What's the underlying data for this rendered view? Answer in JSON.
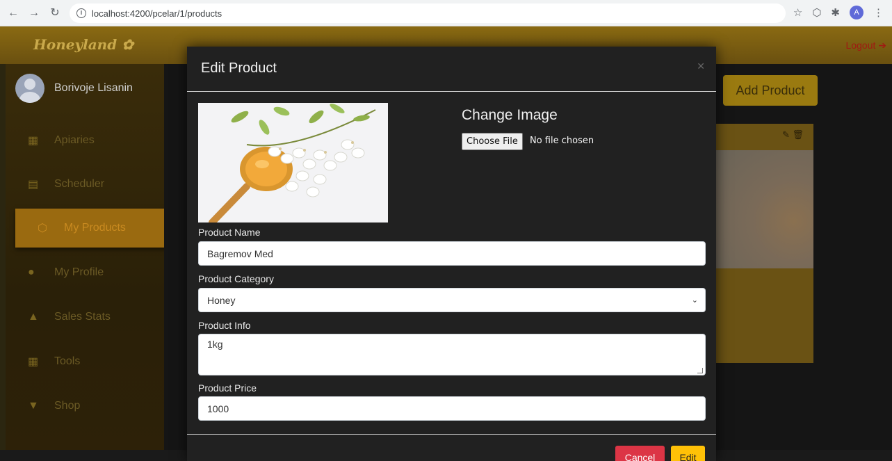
{
  "browser": {
    "url": "localhost:4200/pcelar/1/products",
    "profile_initial": "A"
  },
  "app": {
    "logo": "Honeyland",
    "logout": "Logout",
    "user_name": "Borivoje Lisanin",
    "sidebar": {
      "items": [
        {
          "label": "Apiaries",
          "icon": "hive-icon",
          "glyph": "▦"
        },
        {
          "label": "Scheduler",
          "icon": "calendar-icon",
          "glyph": "▤"
        },
        {
          "label": "My Products",
          "icon": "honeycomb-icon",
          "glyph": "⬡"
        },
        {
          "label": "My Profile",
          "icon": "user-icon",
          "glyph": "●"
        },
        {
          "label": "Sales Stats",
          "icon": "chart-icon",
          "glyph": "▲"
        },
        {
          "label": "Tools",
          "icon": "calculator-icon",
          "glyph": "▦"
        },
        {
          "label": "Shop",
          "icon": "cart-icon",
          "glyph": "▼"
        }
      ],
      "active_index": 2
    },
    "add_product_label": "Add Product"
  },
  "modal": {
    "title": "Edit Product",
    "change_image_title": "Change Image",
    "choose_file_label": "Choose File",
    "no_file_text": "No file chosen",
    "product_name_label": "Product Name",
    "product_name_value": "Bagremov Med",
    "product_category_label": "Product Category",
    "product_category_value": "Honey",
    "product_info_label": "Product Info",
    "product_info_value": "1kg",
    "product_price_label": "Product Price",
    "product_price_value": "1000",
    "cancel_label": "Cancel",
    "edit_label": "Edit"
  }
}
